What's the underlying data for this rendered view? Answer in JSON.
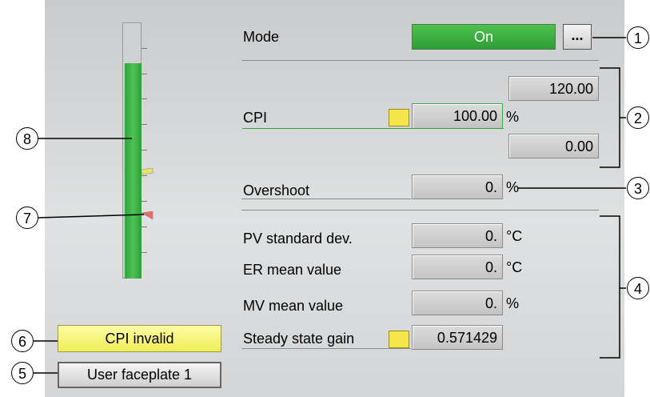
{
  "mode": {
    "label": "Mode",
    "value": "On",
    "more_label": "..."
  },
  "cpi": {
    "label": "CPI",
    "high_limit": "120.00",
    "value": "100.00",
    "unit": "%",
    "low_limit": "0.00"
  },
  "overshoot": {
    "label": "Overshoot",
    "value": "0.",
    "unit": "%"
  },
  "stats": [
    {
      "label": "PV standard dev.",
      "value": "0.",
      "unit": "°C"
    },
    {
      "label": "ER mean value",
      "value": "0.",
      "unit": "°C"
    },
    {
      "label": "MV mean value",
      "value": "0.",
      "unit": "%"
    },
    {
      "label": "Steady state gain",
      "value": "0.571429",
      "unit": ""
    }
  ],
  "buttons": {
    "cpi_invalid": "CPI invalid",
    "user_faceplate": "User faceplate 1"
  },
  "bar": {
    "fill_fraction": 0.84
  },
  "callouts": [
    "1",
    "2",
    "3",
    "4",
    "5",
    "6",
    "7",
    "8"
  ],
  "colors": {
    "mode_on": "#3cb043",
    "cpi_invalid": "#f4f268",
    "bar": "#3fb449"
  }
}
